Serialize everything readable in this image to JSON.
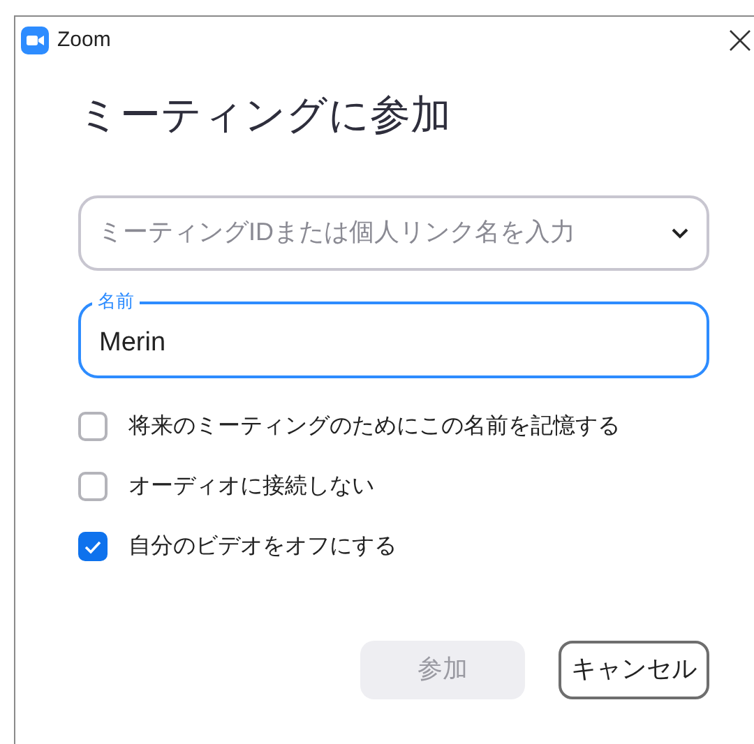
{
  "window": {
    "title": "Zoom"
  },
  "heading": "ミーティングに参加",
  "meeting_field": {
    "placeholder": "ミーティングIDまたは個人リンク名を入力"
  },
  "name_field": {
    "label": "名前",
    "value": "Merin",
    "focused": true
  },
  "options": [
    {
      "label": "将来のミーティングのためにこの名前を記憶する",
      "checked": false
    },
    {
      "label": "オーディオに接続しない",
      "checked": false
    },
    {
      "label": "自分のビデオをオフにする",
      "checked": true
    }
  ],
  "buttons": [
    {
      "label": "参加",
      "kind": "primary",
      "disabled": true
    },
    {
      "label": "キャンセル",
      "kind": "secondary",
      "disabled": false
    }
  ]
}
